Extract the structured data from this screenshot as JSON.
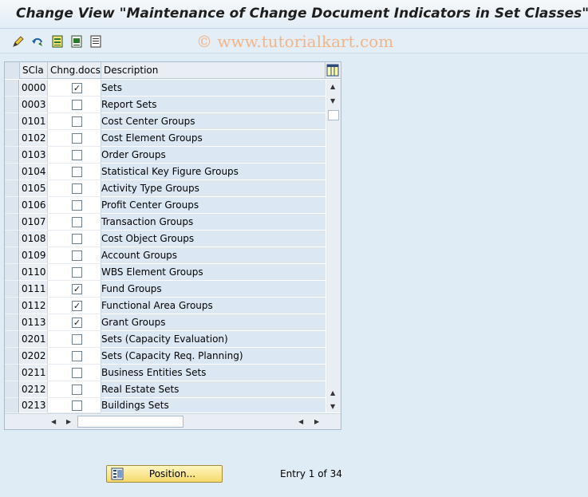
{
  "window": {
    "title": "Change View \"Maintenance of Change Document Indicators in Set Classes\""
  },
  "toolbar": {
    "icons": [
      "display-change-icon",
      "undo-icon",
      "select-all-icon",
      "select-block-icon",
      "deselect-all-icon"
    ]
  },
  "watermark": "© www.tutorialkart.com",
  "table": {
    "columns": [
      "SCla",
      "Chng.docs",
      "Description"
    ],
    "rows": [
      {
        "scla": "0000",
        "chng": true,
        "desc": "Sets"
      },
      {
        "scla": "0003",
        "chng": false,
        "desc": "Report Sets"
      },
      {
        "scla": "0101",
        "chng": false,
        "desc": "Cost Center Groups"
      },
      {
        "scla": "0102",
        "chng": false,
        "desc": "Cost Element Groups"
      },
      {
        "scla": "0103",
        "chng": false,
        "desc": "Order Groups"
      },
      {
        "scla": "0104",
        "chng": false,
        "desc": "Statistical Key Figure Groups"
      },
      {
        "scla": "0105",
        "chng": false,
        "desc": "Activity Type Groups"
      },
      {
        "scla": "0106",
        "chng": false,
        "desc": "Profit Center Groups"
      },
      {
        "scla": "0107",
        "chng": false,
        "desc": "Transaction Groups"
      },
      {
        "scla": "0108",
        "chng": false,
        "desc": "Cost Object Groups"
      },
      {
        "scla": "0109",
        "chng": false,
        "desc": "Account Groups"
      },
      {
        "scla": "0110",
        "chng": false,
        "desc": "WBS Element Groups"
      },
      {
        "scla": "0111",
        "chng": true,
        "desc": "Fund Groups"
      },
      {
        "scla": "0112",
        "chng": true,
        "desc": "Functional Area Groups"
      },
      {
        "scla": "0113",
        "chng": true,
        "desc": "Grant Groups"
      },
      {
        "scla": "0201",
        "chng": false,
        "desc": "Sets (Capacity Evaluation)"
      },
      {
        "scla": "0202",
        "chng": false,
        "desc": "Sets (Capacity Req. Planning)"
      },
      {
        "scla": "0211",
        "chng": false,
        "desc": "Business Entities Sets"
      },
      {
        "scla": "0212",
        "chng": false,
        "desc": "Real Estate Sets"
      },
      {
        "scla": "0213",
        "chng": false,
        "desc": "Buildings Sets"
      }
    ]
  },
  "footer": {
    "position_button": "Position...",
    "entry_text": "Entry 1 of 34"
  },
  "colors": {
    "background": "#dfebf5",
    "row_desc": "#dbe8f3",
    "button": "#f5d96a"
  }
}
